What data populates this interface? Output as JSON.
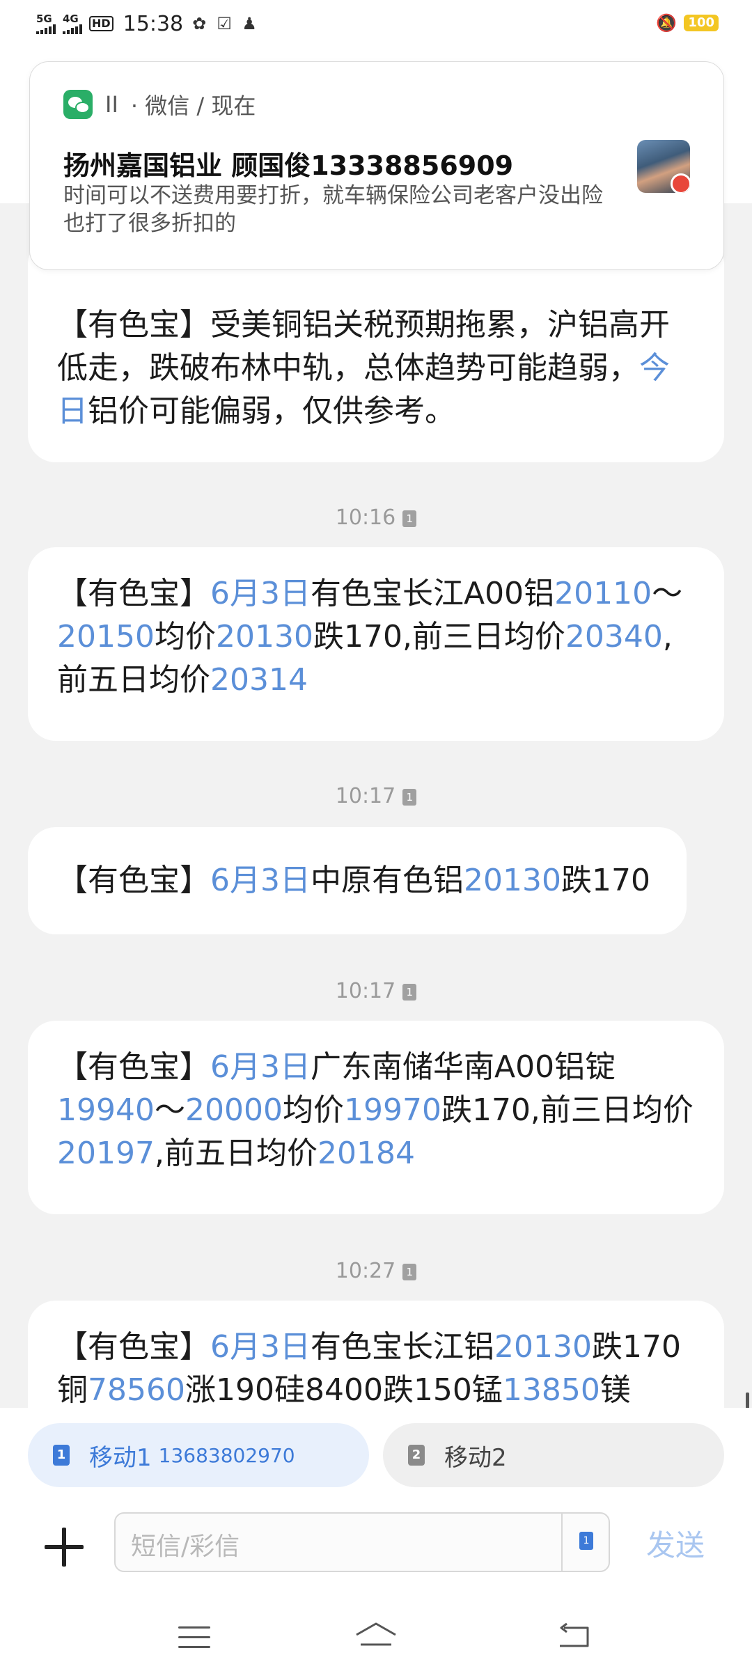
{
  "status_bar": {
    "sig1_label": "5G",
    "sig2_label": "4G",
    "hd_label": "HD",
    "time": "15:38",
    "battery": "100"
  },
  "notification": {
    "app_sep": "II",
    "app_name": "· 微信 / 现在",
    "title": "扬州嘉国铝业 顾国俊13338856909",
    "body": "时间可以不送费用要打折，就车辆保险公司老客户没出险也打了很多折扣的"
  },
  "messages": [
    {
      "segments": [
        {
          "t": "【有色宝】受美铜铝关税预期拖累，沪铝高开低走，跌破布林中轨，总体趋势可能趋弱，"
        },
        {
          "t": "今日",
          "hl": true
        },
        {
          "t": "铝价可能偏弱，仅供参考。"
        }
      ]
    },
    {
      "time": "10:16",
      "segments": [
        {
          "t": "【有色宝】"
        },
        {
          "t": "6月3日",
          "hl": true
        },
        {
          "t": "有色宝长江A00铝"
        },
        {
          "t": "20110",
          "hl": true
        },
        {
          "t": "～"
        },
        {
          "t": "20150",
          "hl": true
        },
        {
          "t": "均价"
        },
        {
          "t": "20130",
          "hl": true
        },
        {
          "t": "跌170,前三日均价"
        },
        {
          "t": "20340",
          "hl": true
        },
        {
          "t": ","
        },
        {
          "t": "前五日均价"
        },
        {
          "t": "20314",
          "hl": true
        }
      ]
    },
    {
      "time": "10:17",
      "segments": [
        {
          "t": "【有色宝】"
        },
        {
          "t": "6月3日",
          "hl": true
        },
        {
          "t": "中原有色铝"
        },
        {
          "t": "20130",
          "hl": true
        },
        {
          "t": "跌170"
        }
      ]
    },
    {
      "time": "10:17",
      "segments": [
        {
          "t": "【有色宝】"
        },
        {
          "t": "6月3日",
          "hl": true
        },
        {
          "t": "广东南储华南A00铝锭"
        },
        {
          "t": "19940",
          "hl": true
        },
        {
          "t": "～"
        },
        {
          "t": "20000",
          "hl": true
        },
        {
          "t": "均价"
        },
        {
          "t": "19970",
          "hl": true
        },
        {
          "t": "跌170,前三日均价"
        },
        {
          "t": "20197",
          "hl": true
        },
        {
          "t": ",前五日均价"
        },
        {
          "t": "20184",
          "hl": true
        }
      ]
    },
    {
      "time": "10:27",
      "segments": [
        {
          "t": "【有色宝】"
        },
        {
          "t": "6月3日",
          "hl": true
        },
        {
          "t": "有色宝长江铝"
        },
        {
          "t": "20130",
          "hl": true
        },
        {
          "t": "跌170"
        },
        {
          "t": "铜"
        },
        {
          "t": "78560",
          "hl": true
        },
        {
          "t": "涨190硅8400跌150锰"
        },
        {
          "t": "13850",
          "hl": true
        },
        {
          "t": "镁"
        }
      ]
    }
  ],
  "sim_selector": {
    "sim1_badge": "1",
    "sim1_label": "移动1",
    "sim1_number": "13683802970",
    "sim2_badge": "2",
    "sim2_label": "移动2"
  },
  "composer": {
    "placeholder": "短信/彩信",
    "sim_badge": "1",
    "send_label": "发送"
  },
  "colors": {
    "highlight": "#5b8fd8",
    "send_disabled": "#a9c6f0",
    "wechat_green": "#2aae67",
    "battery": "#f3c623"
  }
}
